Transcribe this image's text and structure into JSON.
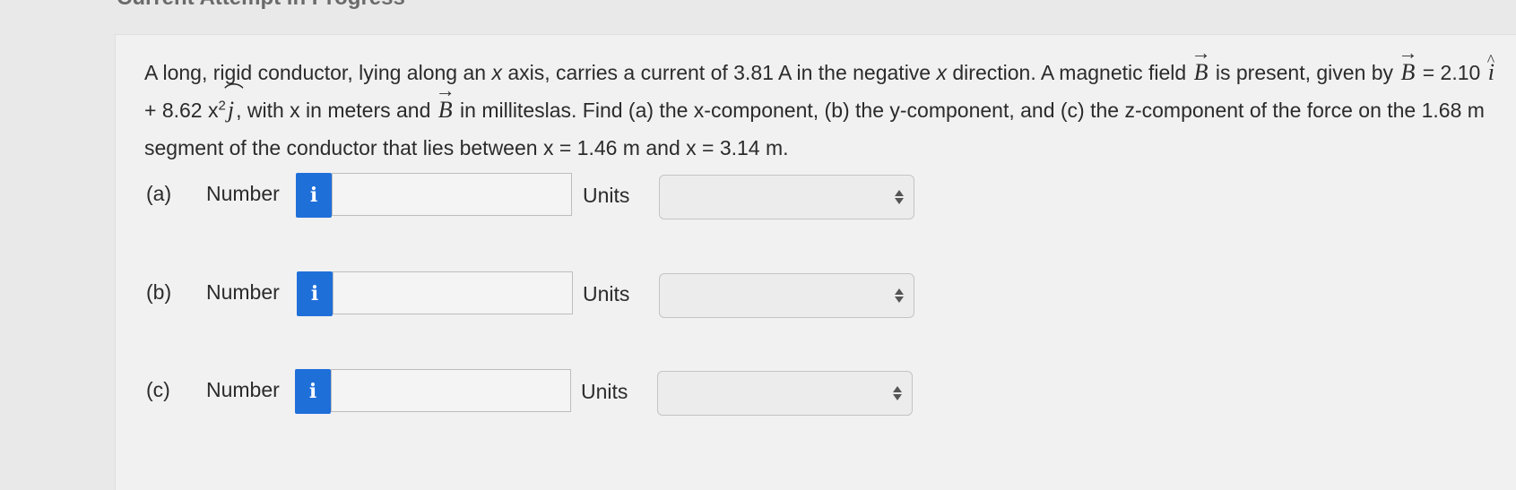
{
  "heading": "Current Attempt in Progress",
  "question": {
    "t1": "A long, rigid conductor, lying along an ",
    "xvar1": "x",
    "t2": " axis, carries a current of 3.81 A in the negative ",
    "xvar2": "x",
    "t3": " direction. A magnetic field ",
    "Bsym": "B",
    "t4": " is present, given by ",
    "t5": " = 2.10 ",
    "ihat": "i",
    "t6": " + 8.62 x",
    "exp": "2",
    "jhat": "j",
    "t7": ", with x in meters and ",
    "t8": " in milliteslas. Find (a) the x-component, (b) the y-component, and (c) the z-component of the force on the 1.68 m segment of the conductor that lies between x = 1.46 m and x = 3.14 m."
  },
  "answers": [
    {
      "letter": "(a)",
      "number_label": "Number",
      "info_icon": "i",
      "value": "",
      "units_label": "Units",
      "units_value": ""
    },
    {
      "letter": "(b)",
      "number_label": "Number",
      "info_icon": "i",
      "value": "",
      "units_label": "Units",
      "units_value": ""
    },
    {
      "letter": "(c)",
      "number_label": "Number",
      "info_icon": "i",
      "value": "",
      "units_label": "Units",
      "units_value": ""
    }
  ],
  "icons": {
    "info": "info-icon",
    "select_arrows": "updown-arrows-icon"
  },
  "colors": {
    "info_button": "#1f6fd9",
    "background": "#e9e9e9",
    "panel": "#f1f1f1"
  }
}
